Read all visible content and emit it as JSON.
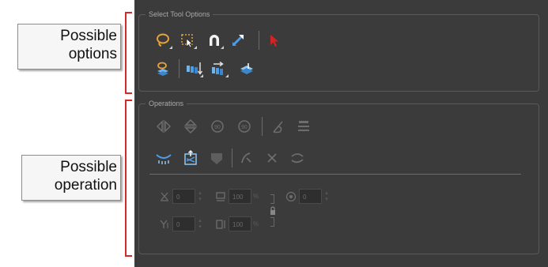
{
  "panel": {
    "select_tool_options": {
      "title": "Select Tool Options",
      "icons": [
        "lasso-icon",
        "marquee-select-icon",
        "snap-magnet-icon",
        "contour-editor-swap-icon",
        "select-arrow-icon",
        "apply-to-drawing-layers-icon",
        "send-back-icon",
        "bring-forward-icon",
        "flatten-icon"
      ]
    },
    "operations": {
      "title": "Operations",
      "icons": [
        "flip-horizontal-icon",
        "flip-vertical-icon",
        "rotate-ccw-90-icon",
        "rotate-cw-90-icon",
        "create-colour-art-icon",
        "distribute-to-layers-icon",
        "smooth-icon",
        "optimize-icon",
        "adjust-thickness-icon",
        "cutter-icon",
        "merge-lines-icon",
        "reshape-icon"
      ],
      "fields": {
        "x": {
          "label": "X",
          "value": "0"
        },
        "width": {
          "value": "100",
          "unit": "%"
        },
        "angle": {
          "value": "0"
        },
        "y": {
          "label": "Y",
          "value": "0"
        },
        "height": {
          "value": "100",
          "unit": "%"
        }
      }
    }
  },
  "callouts": {
    "options": {
      "line1": "Possible",
      "line2": "options"
    },
    "operation": {
      "line1": "Possible",
      "line2": "operation"
    }
  },
  "colors": {
    "panel_bg": "#3b3b3b",
    "accent_orange": "#e8a23a",
    "accent_blue": "#4d9ce8",
    "bracket_red": "#d22a2a"
  }
}
